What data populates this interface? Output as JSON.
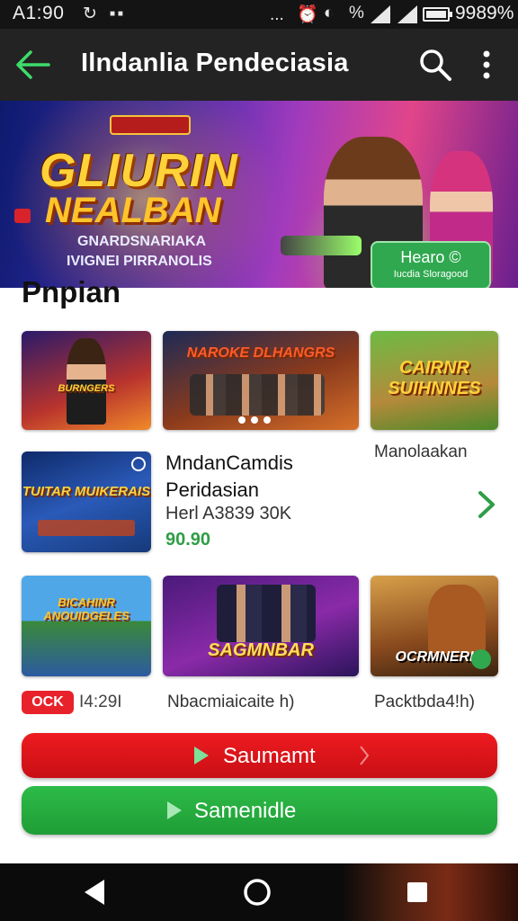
{
  "status_bar": {
    "time": "A1:90",
    "battery": "9989%"
  },
  "app_bar": {
    "title": "Ilndanlia Pendeciasia"
  },
  "hero": {
    "title_line1": "GLIURIN",
    "title_line2": "NEALBAN",
    "subtitle_line1": "GNARDSNARIAKA",
    "subtitle_line2": "IVIGNEI PIRRANOLIS",
    "cta_title": "Hearo",
    "cta_subtitle": "Iucdia Sloragood"
  },
  "section": {
    "title": "Pnpian"
  },
  "row1": [
    {
      "art_text": "BURNGERS",
      "label": ""
    },
    {
      "art_text": "NAROKE DLHANGRS",
      "label": ""
    },
    {
      "art_text": "CAIRNR SUIHNNES",
      "label": "Manolaakan"
    }
  ],
  "featured": {
    "art_text": "TUITAR MUIKERAIS",
    "title_line1": "MndanCamdis",
    "title_line2": "Peridasian",
    "meta": "Herl A3839 30K",
    "price": "90.90"
  },
  "row3": [
    {
      "art_text": "BICAHINR ANOUIDGELES",
      "label": "I4:29I",
      "badge": "OCK"
    },
    {
      "art_text": "SAGMNBAR",
      "label": "Nbacmiaicaite h)"
    },
    {
      "art_text": "OCRMNERI",
      "label": "Packtbda4!h)"
    }
  ],
  "buttons": {
    "primary": "Saumamt",
    "secondary": "Samenidle"
  },
  "colors": {
    "accent_green": "#2fa84f",
    "accent_red": "#e8222b",
    "app_bar": "#232323"
  }
}
